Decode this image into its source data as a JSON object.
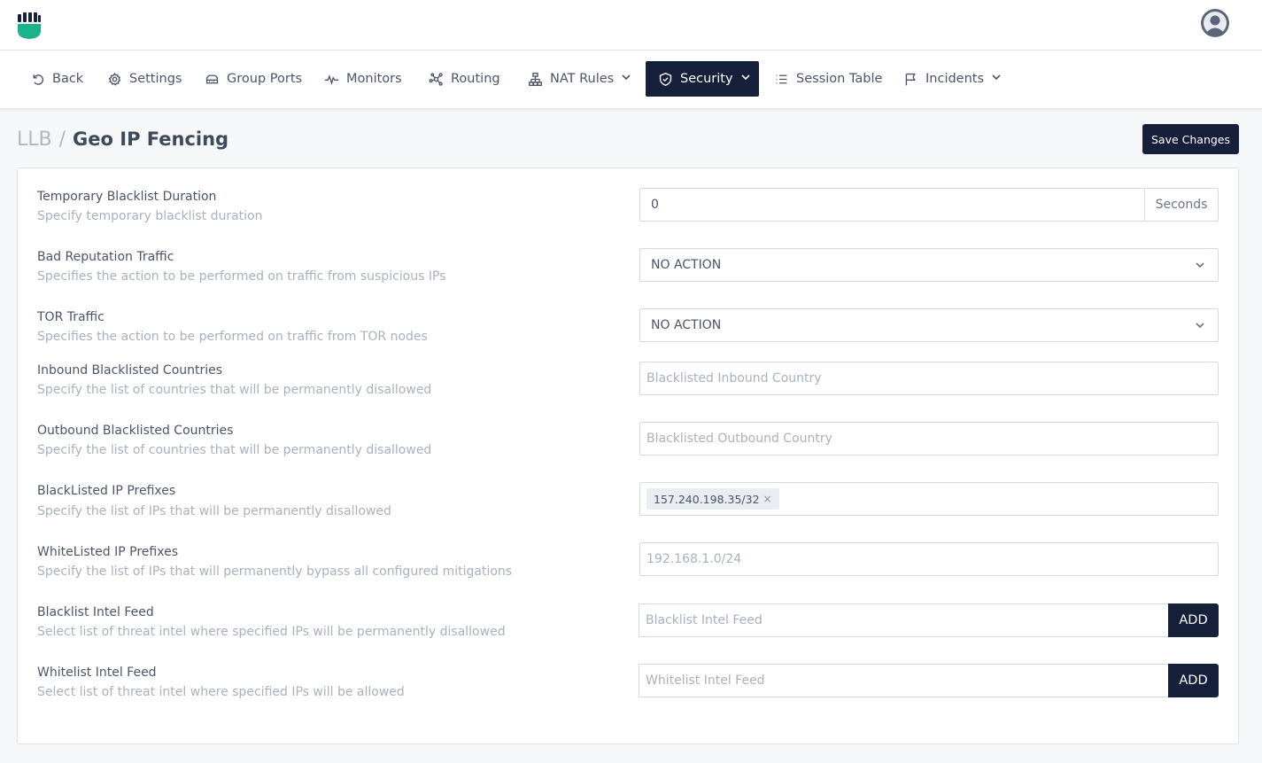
{
  "nav": {
    "items": [
      {
        "label": "Back",
        "icon": "back-icon"
      },
      {
        "label": "Settings",
        "icon": "gear-icon"
      },
      {
        "label": "Group Ports",
        "icon": "ports-icon"
      },
      {
        "label": "Monitors",
        "icon": "pulse-icon"
      },
      {
        "label": "Routing",
        "icon": "routing-icon"
      },
      {
        "label": "NAT Rules",
        "icon": "network-icon"
      },
      {
        "label": "Security",
        "icon": "shield-icon"
      },
      {
        "label": "Session Table",
        "icon": "list-icon"
      },
      {
        "label": "Incidents",
        "icon": "flag-icon"
      }
    ],
    "active": "Security"
  },
  "breadcrumb": {
    "root": "LLB",
    "separator": "/",
    "current": "Geo IP Fencing"
  },
  "actions": {
    "save_label": "Save Changes"
  },
  "form": {
    "temp_blacklist": {
      "label": "Temporary Blacklist Duration",
      "description": "Specify temporary blacklist duration",
      "value": "0",
      "unit": "Seconds"
    },
    "bad_reputation": {
      "label": "Bad Reputation Traffic",
      "description": "Specifies the action to be performed on traffic from suspicious IPs",
      "value": "NO ACTION"
    },
    "tor_traffic": {
      "label": "TOR Traffic",
      "description": "Specifies the action to be performed on traffic from TOR nodes",
      "value": "NO ACTION"
    },
    "inbound_countries": {
      "label": "Inbound Blacklisted Countries",
      "description": "Specify the list of countries that will be permanently disallowed",
      "placeholder": "Blacklisted Inbound Country"
    },
    "outbound_countries": {
      "label": "Outbound Blacklisted Countries",
      "description": "Specify the list of countries that will be permanently disallowed",
      "placeholder": "Blacklisted Outbound Country"
    },
    "blacklisted_prefixes": {
      "label": "BlackListed IP Prefixes",
      "description": "Specify the list of IPs that will be permanently disallowed",
      "tags": [
        "157.240.198.35/32"
      ],
      "tag_remove": "×"
    },
    "whitelisted_prefixes": {
      "label": "WhiteListed IP Prefixes",
      "description": "Specify the list of IPs that will permanently bypass all configured mitigations",
      "placeholder": "192.168.1.0/24"
    },
    "blacklist_feed": {
      "label": "Blacklist Intel Feed",
      "description": "Select list of threat intel where specified IPs will be permanently disallowed",
      "placeholder": "Blacklist Intel Feed",
      "button": "ADD"
    },
    "whitelist_feed": {
      "label": "Whitelist Intel Feed",
      "description": "Select list of threat intel where specified IPs will be allowed",
      "placeholder": "Whitelist Intel Feed",
      "button": "ADD"
    }
  },
  "colors": {
    "primary_dark": "#16203a",
    "brand_green": "#1bb28c"
  }
}
